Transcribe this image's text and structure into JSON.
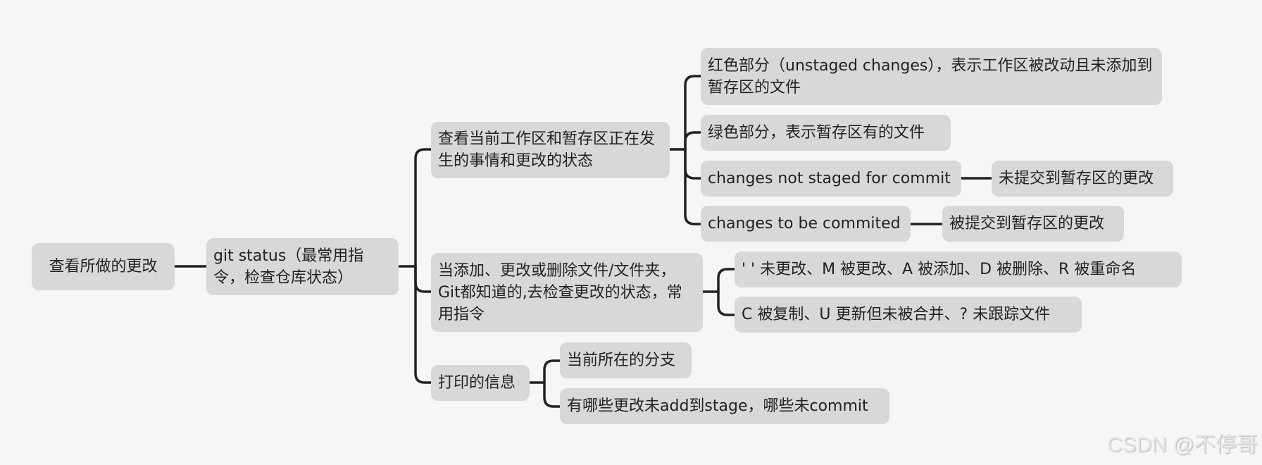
{
  "root": {
    "label": "查看所做的更改"
  },
  "command": {
    "label": "git status（最常用指令，检查仓库状态）"
  },
  "branches": [
    {
      "label": "查看当前工作区和暂存区正在发生的事情和更改的状态",
      "children": [
        {
          "label": "红色部分（unstaged changes），表示工作区被改动且未添加到暂存区的文件"
        },
        {
          "label": "绿色部分，表示暂存区有的文件"
        },
        {
          "label": "changes not staged for commit",
          "child": "未提交到暂存区的更改"
        },
        {
          "label": "changes to be commited",
          "child": "被提交到暂存区的更改"
        }
      ]
    },
    {
      "label": "当添加、更改或删除文件/文件夹，Git都知道的,去检查更改的状态，常用指令",
      "children": [
        {
          "label": "' ' 未更改、M 被更改、A 被添加、D 被删除、R 被重命名"
        },
        {
          "label": "C 被复制、U 更新但未被合并、? 未跟踪文件"
        }
      ]
    },
    {
      "label": "打印的信息",
      "children": [
        {
          "label": "当前所在的分支"
        },
        {
          "label": "有哪些更改未add到stage，哪些未commit"
        }
      ]
    }
  ],
  "watermark": "CSDN @不停哥",
  "colors": {
    "background": "#f6f6f6",
    "node": "#d8d8d8",
    "line": "#222222"
  }
}
